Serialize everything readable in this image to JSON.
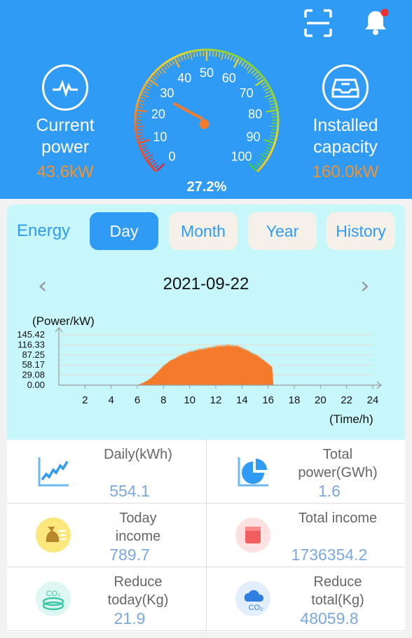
{
  "header": {
    "current_power": {
      "label": "Current\npower",
      "value": "43.6kW"
    },
    "installed_capacity": {
      "label": "Installed\ncapacity",
      "value": "160.0kW"
    },
    "gauge": {
      "percent_label": "27.2%",
      "percent": 27.2,
      "ticks": [
        "0",
        "10",
        "20",
        "30",
        "40",
        "50",
        "60",
        "70",
        "80",
        "90",
        "100"
      ]
    },
    "icons": {
      "scan": "scan-icon",
      "notifications": "bell-icon",
      "notification_dot_color": "#f03030"
    }
  },
  "energy": {
    "label": "Energy",
    "tabs": [
      "Day",
      "Month",
      "Year",
      "History"
    ],
    "active_tab": "Day",
    "date": "2021-09-22",
    "prev_symbol": "‹",
    "next_symbol": "›"
  },
  "chart_data": {
    "type": "area",
    "ylabel": "(Power/kW)",
    "xlabel": "(Time/h)",
    "y_ticks": [
      "145.42",
      "116.33",
      "87.25",
      "58.17",
      "29.08",
      "0.00"
    ],
    "y_tick_values": [
      145.42,
      116.33,
      87.25,
      58.17,
      29.08,
      0
    ],
    "x_ticks": [
      "2",
      "4",
      "6",
      "8",
      "10",
      "12",
      "14",
      "16",
      "18",
      "20",
      "22",
      "24"
    ],
    "xlim": [
      0,
      24
    ],
    "ylim": [
      0,
      145.42
    ],
    "color": "#f47b2c",
    "x": [
      6.0,
      6.5,
      7.0,
      7.5,
      8.0,
      8.5,
      9.0,
      9.5,
      10.0,
      10.5,
      11.0,
      11.5,
      12.0,
      12.5,
      13.0,
      13.5,
      14.0,
      14.5,
      15.0,
      15.5,
      16.0,
      16.3,
      16.4
    ],
    "y": [
      0,
      8,
      20,
      38,
      58,
      73,
      83,
      93,
      100,
      105,
      109,
      112,
      116,
      118,
      119,
      118,
      112,
      102,
      92,
      80,
      64,
      55,
      0
    ]
  },
  "stats": [
    {
      "title": "Daily(kWh)",
      "value": "554.1",
      "icon": "trend-chart-icon"
    },
    {
      "title": "Total\npower(GWh)",
      "value": "1.6",
      "icon": "pie-chart-icon"
    },
    {
      "title": "Today\nincome",
      "value": "789.7",
      "icon": "money-bag-icon"
    },
    {
      "title": "Total income",
      "value": "1736354.2",
      "icon": "wallet-icon"
    },
    {
      "title": "Reduce\ntoday(Kg)",
      "value": "21.9",
      "icon": "co2-coins-icon"
    },
    {
      "title": "Reduce\ntotal(Kg)",
      "value": "48059.8",
      "icon": "co2-cloud-icon"
    }
  ]
}
